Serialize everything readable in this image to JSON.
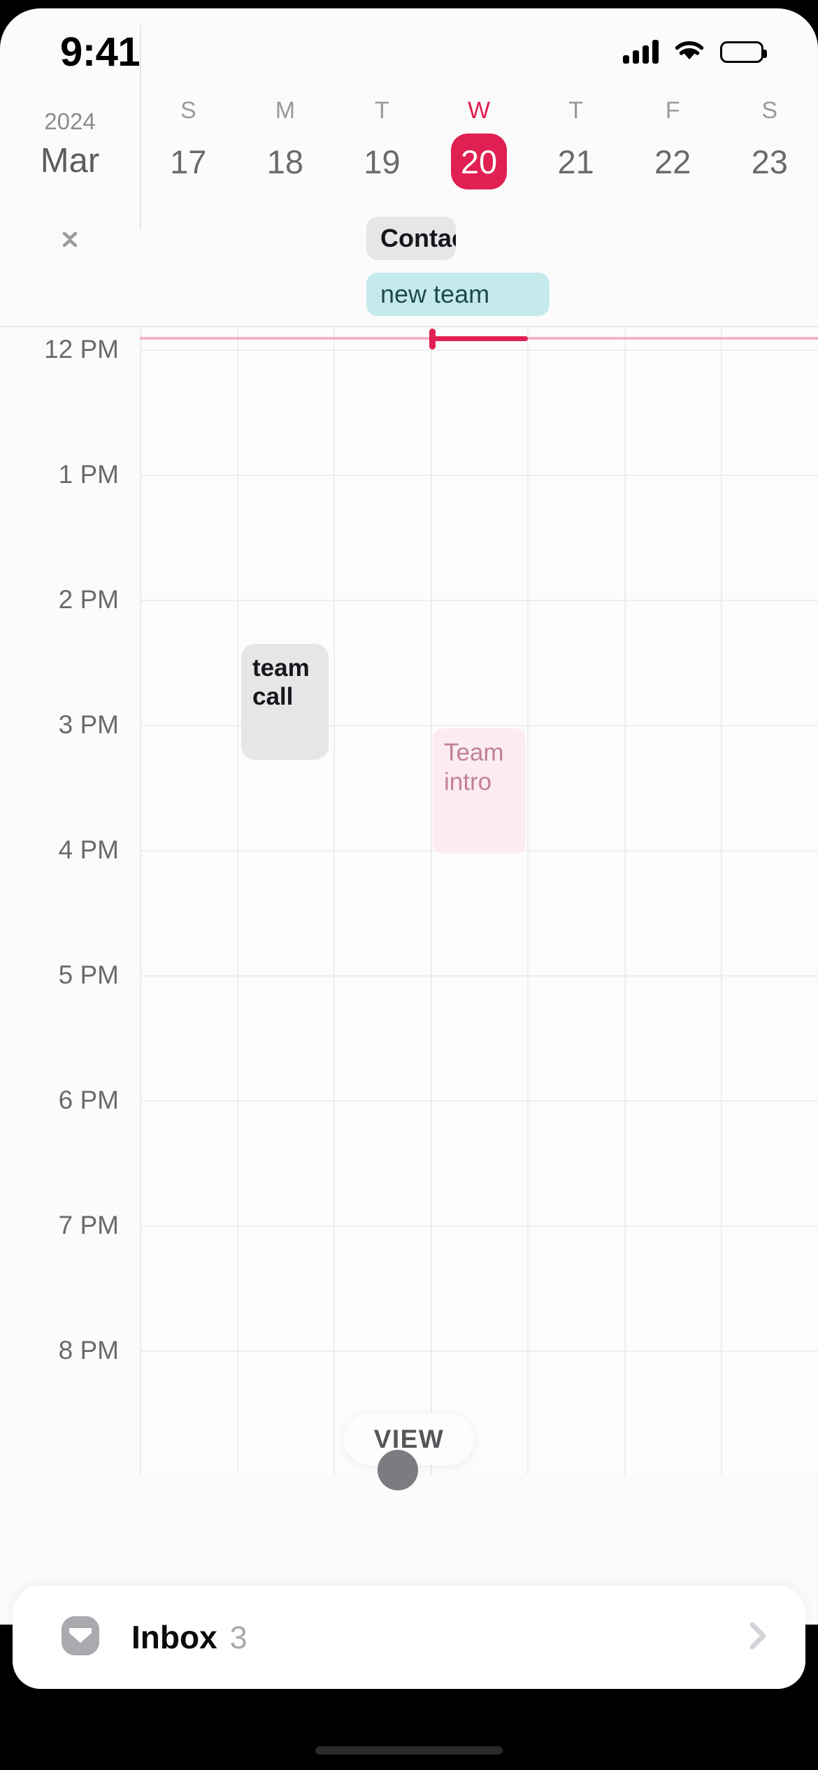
{
  "status_bar": {
    "time": "9:41",
    "signal_icon": "cellular-bars-icon",
    "wifi_icon": "wifi-icon",
    "battery_icon": "battery-full-icon"
  },
  "calendar": {
    "year": "2024",
    "month": "Mar",
    "accent_color": "#e01f52",
    "collapse_icon": "collapse-chevrons-icon",
    "days": [
      {
        "letter": "S",
        "num": "17",
        "today": false
      },
      {
        "letter": "M",
        "num": "18",
        "today": false
      },
      {
        "letter": "T",
        "num": "19",
        "today": false
      },
      {
        "letter": "W",
        "num": "20",
        "today": true
      },
      {
        "letter": "T",
        "num": "21",
        "today": false
      },
      {
        "letter": "F",
        "num": "22",
        "today": false
      },
      {
        "letter": "S",
        "num": "23",
        "today": false
      }
    ],
    "all_day_events": [
      {
        "title": "Contac",
        "color": "#e6e5e7",
        "text_color": "#16161a"
      },
      {
        "title": "new team",
        "color": "#c5eaec",
        "text_color": "#1f4a4d"
      }
    ],
    "time_labels": [
      "12 PM",
      "1 PM",
      "2 PM",
      "3 PM",
      "4 PM",
      "5 PM",
      "6 PM",
      "7 PM",
      "8 PM"
    ],
    "events": [
      {
        "title": "team call",
        "color": "#e6e5e7",
        "text_color": "#17171b"
      },
      {
        "title": "Team intro",
        "color": "#fcecf2",
        "text_color": "#c08098"
      }
    ],
    "now_indicator_color": "#e01f52",
    "view_button": "VIEW"
  },
  "tabbar": {
    "person_icon": "person-icon",
    "search_icon": "search-icon",
    "dot_icon": "dot-icon",
    "home_handle_icon": "drag-handle-icon",
    "add_icon": "plus-circle-icon"
  },
  "inbox": {
    "mail_icon": "mail-icon",
    "label": "Inbox",
    "count": "3",
    "chevron_icon": "chevron-right-icon"
  }
}
